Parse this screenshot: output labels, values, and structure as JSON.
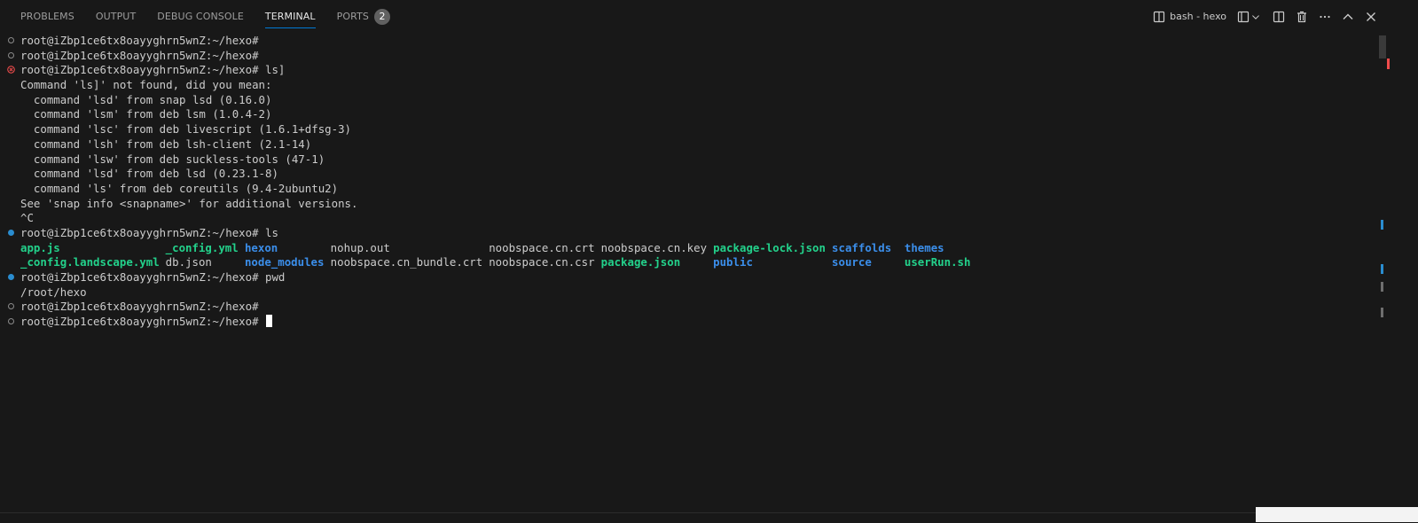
{
  "panel": {
    "tabs": [
      {
        "label": "PROBLEMS"
      },
      {
        "label": "OUTPUT"
      },
      {
        "label": "DEBUG CONSOLE"
      },
      {
        "label": "TERMINAL",
        "active": true
      },
      {
        "label": "PORTS",
        "badge": "2"
      }
    ],
    "active_terminal_label": "bash - hexo",
    "action_icons": [
      "terminal-icon",
      "split-terminal-icon",
      "chevron-down-icon",
      "split-panel-icon",
      "trash-icon",
      "ellipsis-icon",
      "chevron-up-icon",
      "close-icon"
    ]
  },
  "terminal": {
    "prompt": "root@iZbp1ce6tx8oayyghrn5wnZ:~/hexo#",
    "lines": [
      {
        "deco": "plain",
        "text": "root@iZbp1ce6tx8oayyghrn5wnZ:~/hexo#"
      },
      {
        "deco": "plain",
        "text": "root@iZbp1ce6tx8oayyghrn5wnZ:~/hexo#"
      },
      {
        "deco": "err",
        "text": "root@iZbp1ce6tx8oayyghrn5wnZ:~/hexo# ls]"
      },
      {
        "deco": "",
        "text": "Command 'ls]' not found, did you mean:"
      },
      {
        "deco": "",
        "text": "  command 'lsd' from snap lsd (0.16.0)"
      },
      {
        "deco": "",
        "text": "  command 'lsm' from deb lsm (1.0.4-2)"
      },
      {
        "deco": "",
        "text": "  command 'lsc' from deb livescript (1.6.1+dfsg-3)"
      },
      {
        "deco": "",
        "text": "  command 'lsh' from deb lsh-client (2.1-14)"
      },
      {
        "deco": "",
        "text": "  command 'lsw' from deb suckless-tools (47-1)"
      },
      {
        "deco": "",
        "text": "  command 'lsd' from deb lsd (0.23.1-8)"
      },
      {
        "deco": "",
        "text": "  command 'ls' from deb coreutils (9.4-2ubuntu2)"
      },
      {
        "deco": "",
        "text": "See 'snap info <snapname>' for additional versions."
      },
      {
        "deco": "",
        "text": "^C"
      },
      {
        "deco": "ok",
        "text": "root@iZbp1ce6tx8oayyghrn5wnZ:~/hexo# ls"
      }
    ],
    "ls_rows": [
      [
        {
          "text": "app.js",
          "color": "green"
        },
        {
          "text": "_config.yml",
          "color": "green"
        },
        {
          "text": "hexon",
          "color": "blue"
        },
        {
          "text": "nohup.out",
          "color": "plain"
        },
        {
          "text": "noobspace.cn.crt",
          "color": "plain"
        },
        {
          "text": "noobspace.cn.key",
          "color": "plain"
        },
        {
          "text": "package-lock.json",
          "color": "green"
        },
        {
          "text": "scaffolds",
          "color": "blue"
        },
        {
          "text": "themes",
          "color": "blue"
        }
      ],
      [
        {
          "text": "_config.landscape.yml",
          "color": "green"
        },
        {
          "text": "db.json",
          "color": "plain"
        },
        {
          "text": "node_modules",
          "color": "blue"
        },
        {
          "text": "noobspace.cn_bundle.crt",
          "color": "plain"
        },
        {
          "text": "noobspace.cn.csr",
          "color": "plain"
        },
        {
          "text": "package.json",
          "color": "green"
        },
        {
          "text": "public",
          "color": "blue"
        },
        {
          "text": "source",
          "color": "blue"
        },
        {
          "text": "userRun.sh",
          "color": "green"
        }
      ]
    ],
    "after_lines": [
      {
        "deco": "ok",
        "text": "root@iZbp1ce6tx8oayyghrn5wnZ:~/hexo# pwd"
      },
      {
        "deco": "",
        "text": "/root/hexo"
      },
      {
        "deco": "plain",
        "text": "root@iZbp1ce6tx8oayyghrn5wnZ:~/hexo#"
      },
      {
        "deco": "plain",
        "text": "root@iZbp1ce6tx8oayyghrn5wnZ:~/hexo# ",
        "cursor": true
      }
    ]
  },
  "colors": {
    "background": "#181818",
    "green": "#23d18b",
    "blue": "#3b8eea",
    "accent": "#0078d4",
    "error": "#f14c4c"
  }
}
